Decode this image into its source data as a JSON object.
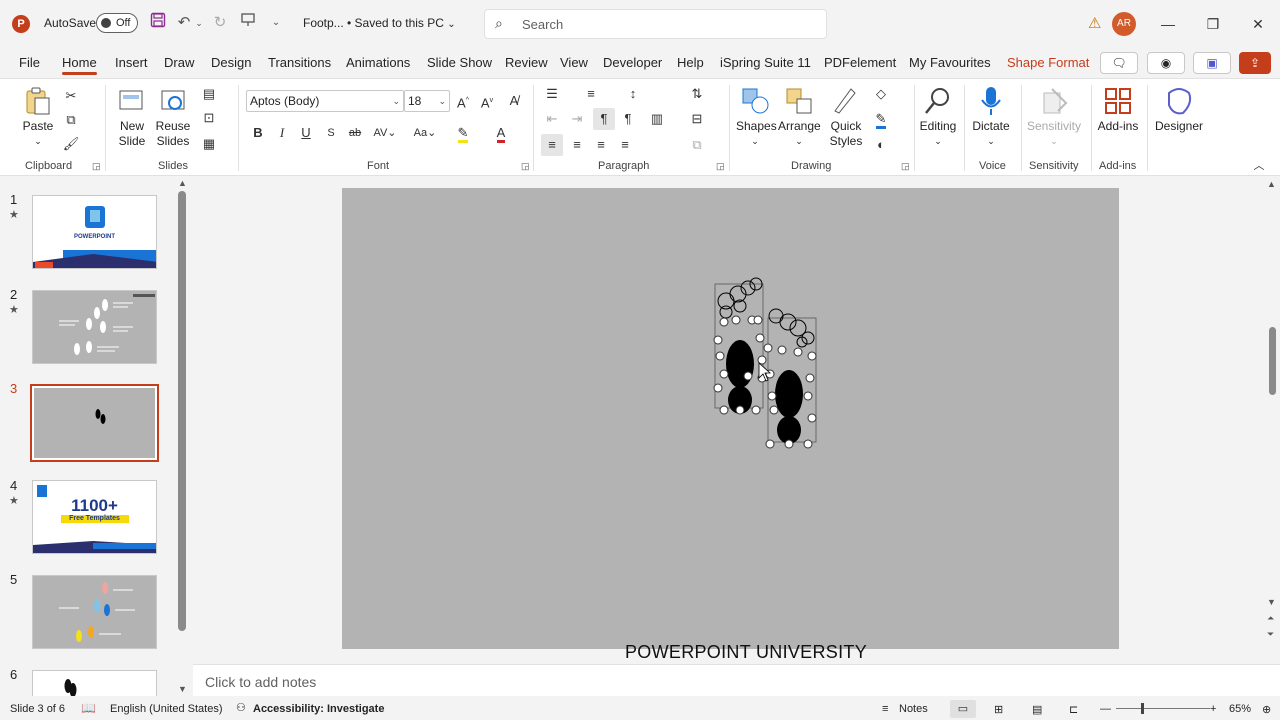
{
  "titlebar": {
    "app_icon": "P",
    "autosave_label": "AutoSave",
    "autosave_state": "Off",
    "doc_title": "Footp... • Saved to this PC",
    "search_placeholder": "Search",
    "user_initials": "AR",
    "icons": [
      "save-icon",
      "undo-icon",
      "redo-icon",
      "present-icon",
      "customize-qat-icon",
      "warning-icon"
    ]
  },
  "tabs": [
    "File",
    "Home",
    "Insert",
    "Draw",
    "Design",
    "Transitions",
    "Animations",
    "Slide Show",
    "Review",
    "View",
    "Developer",
    "Help",
    "iSpring Suite 11",
    "PDFelement",
    "My Favourites",
    "Shape Format"
  ],
  "active_tab": "Home",
  "ribbon": {
    "clipboard": {
      "label": "Clipboard",
      "paste": "Paste"
    },
    "slides": {
      "label": "Slides",
      "new_slide": "New Slide",
      "reuse_slides": "Reuse Slides"
    },
    "font": {
      "label": "Font",
      "font_name": "Aptos (Body)",
      "font_size": "18",
      "bold": "B",
      "italic": "I",
      "underline": "U",
      "strike": "ab"
    },
    "paragraph": {
      "label": "Paragraph"
    },
    "drawing": {
      "label": "Drawing",
      "shapes": "Shapes",
      "arrange": "Arrange",
      "quick_styles": "Quick Styles"
    },
    "voice": {
      "label": "Voice",
      "dictate": "Dictate",
      "editing": "Editing"
    },
    "sensitivity": {
      "label": "Sensitivity",
      "button": "Sensitivity"
    },
    "addins": {
      "label": "Add-ins",
      "button": "Add-ins"
    },
    "designer": {
      "button": "Designer"
    }
  },
  "thumbnails": [
    {
      "num": "1",
      "star": true,
      "title": "POWERPOINT"
    },
    {
      "num": "2",
      "star": true
    },
    {
      "num": "3",
      "star": false,
      "selected": true
    },
    {
      "num": "4",
      "star": true,
      "line1": "1100+",
      "line2": "Free Templates"
    },
    {
      "num": "5",
      "star": false
    },
    {
      "num": "6",
      "star": false
    }
  ],
  "slide_caption": "POWERPOINT UNIVERSITY",
  "notes_placeholder": "Click to add notes",
  "statusbar": {
    "slide_info": "Slide 3 of 6",
    "language": "English (United States)",
    "accessibility": "Accessibility: Investigate",
    "notes": "Notes",
    "zoom": "65%"
  },
  "colors": {
    "accent": "#c43e1c",
    "slide_bg": "#b3b3b3",
    "thumb_blue": "#1a74d6"
  }
}
